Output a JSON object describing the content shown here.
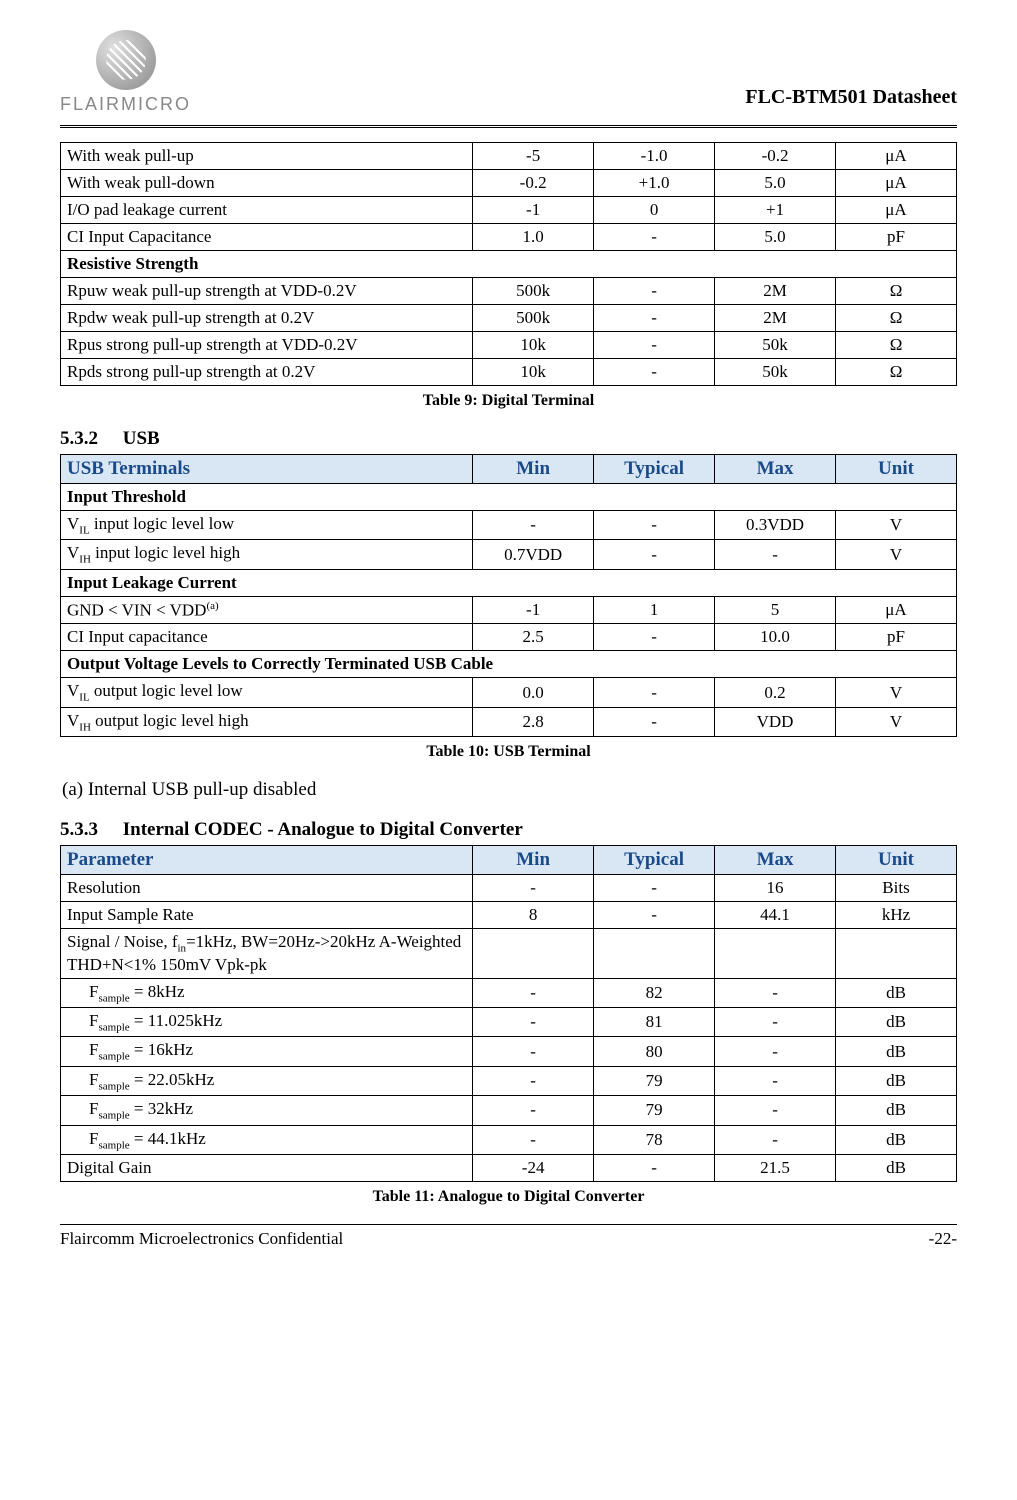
{
  "header": {
    "logo_text": "FLAIRMICRO",
    "doc_title": "FLC-BTM501 Datasheet"
  },
  "table9": {
    "rows": [
      {
        "param": "With weak pull-up",
        "min": "-5",
        "typ": "-1.0",
        "max": "-0.2",
        "unit": "μA"
      },
      {
        "param": "With weak pull-down",
        "min": "-0.2",
        "typ": "+1.0",
        "max": "5.0",
        "unit": "μA"
      },
      {
        "param": "I/O pad leakage current",
        "min": "-1",
        "typ": "0",
        "max": "+1",
        "unit": "μA"
      },
      {
        "param": "CI Input Capacitance",
        "min": "1.0",
        "typ": "-",
        "max": "5.0",
        "unit": "pF"
      }
    ],
    "section_header": "Resistive Strength",
    "rows2": [
      {
        "param": "Rpuw weak pull-up strength at VDD-0.2V",
        "min": "500k",
        "typ": "-",
        "max": "2M",
        "unit": "Ω"
      },
      {
        "param": "Rpdw weak pull-up strength at 0.2V",
        "min": "500k",
        "typ": "-",
        "max": "2M",
        "unit": "Ω"
      },
      {
        "param": "Rpus strong pull-up strength at VDD-0.2V",
        "min": "10k",
        "typ": "-",
        "max": "50k",
        "unit": "Ω"
      },
      {
        "param": "Rpds strong pull-up strength at 0.2V",
        "min": "10k",
        "typ": "-",
        "max": "50k",
        "unit": "Ω"
      }
    ],
    "caption": "Table 9: Digital Terminal"
  },
  "section532": {
    "num": "5.3.2",
    "title": "USB"
  },
  "table10": {
    "headers": {
      "param": "USB Terminals",
      "min": "Min",
      "typ": "Typical",
      "max": "Max",
      "unit": "Unit"
    },
    "sec1": "Input Threshold",
    "rows1": [
      {
        "param_html": "V<sub>IL</sub> input logic level low",
        "min": "-",
        "typ": "-",
        "max": "0.3VDD",
        "unit": "V"
      },
      {
        "param_html": "V<sub>IH</sub> input logic level high",
        "min": "0.7VDD",
        "typ": "-",
        "max": "-",
        "unit": "V"
      }
    ],
    "sec2": "Input Leakage Current",
    "rows2": [
      {
        "param_html": "GND < VIN < VDD<sup>(a)</sup>",
        "min": "-1",
        "typ": "1",
        "max": "5",
        "unit": "μA"
      },
      {
        "param_html": "CI Input capacitance",
        "min": "2.5",
        "typ": "-",
        "max": "10.0",
        "unit": "pF"
      }
    ],
    "sec3": "Output Voltage Levels to Correctly Terminated USB Cable",
    "rows3": [
      {
        "param_html": "V<sub>IL</sub> output logic level low",
        "min": "0.0",
        "typ": "-",
        "max": "0.2",
        "unit": "V"
      },
      {
        "param_html": "V<sub>IH</sub> output logic level high",
        "min": "2.8",
        "typ": "-",
        "max": "VDD",
        "unit": "V"
      }
    ],
    "caption": "Table 10: USB Terminal",
    "note": "(a) Internal USB pull-up disabled"
  },
  "section533": {
    "num": "5.3.3",
    "title": "Internal CODEC - Analogue to Digital Converter"
  },
  "table11": {
    "headers": {
      "param": "Parameter",
      "min": "Min",
      "typ": "Typical",
      "max": "Max",
      "unit": "Unit"
    },
    "rows1": [
      {
        "param_html": "Resolution",
        "min": "-",
        "typ": "-",
        "max": "16",
        "unit": "Bits"
      },
      {
        "param_html": "Input Sample Rate",
        "min": "8",
        "typ": "-",
        "max": "44.1",
        "unit": "kHz"
      }
    ],
    "snr_row": {
      "param_html": "Signal / Noise, f<sub>in</sub>=1kHz, BW=20Hz->20kHz A-Weighted THD+N<1% 150mV Vpk-pk",
      "min": "",
      "typ": "",
      "max": "",
      "unit": ""
    },
    "rows2": [
      {
        "param_html": "F<sub>sample</sub> = 8kHz",
        "min": "-",
        "typ": "82",
        "max": "-",
        "unit": "dB",
        "indent": true
      },
      {
        "param_html": "F<sub>sample</sub> = 11.025kHz",
        "min": "-",
        "typ": "81",
        "max": "-",
        "unit": "dB",
        "indent": true
      },
      {
        "param_html": "F<sub>sample</sub> = 16kHz",
        "min": "-",
        "typ": "80",
        "max": "-",
        "unit": "dB",
        "indent": true
      },
      {
        "param_html": "F<sub>sample</sub> = 22.05kHz",
        "min": "-",
        "typ": "79",
        "max": "-",
        "unit": "dB",
        "indent": true
      },
      {
        "param_html": "F<sub>sample</sub> = 32kHz",
        "min": "-",
        "typ": "79",
        "max": "-",
        "unit": "dB",
        "indent": true
      },
      {
        "param_html": "F<sub>sample</sub> = 44.1kHz",
        "min": "-",
        "typ": "78",
        "max": "-",
        "unit": "dB",
        "indent": true
      }
    ],
    "rows3": [
      {
        "param_html": "Digital Gain",
        "min": "-24",
        "typ": "-",
        "max": "21.5",
        "unit": "dB"
      }
    ],
    "caption": "Table 11: Analogue to Digital Converter"
  },
  "footer": {
    "left": "Flaircomm Microelectronics Confidential",
    "right": "-22-"
  }
}
